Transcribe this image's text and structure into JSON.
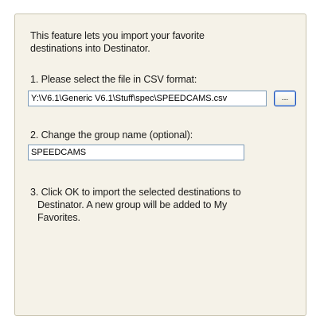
{
  "dialog": {
    "intro_line1": "This feature lets you import your favorite",
    "intro_line2": "destinations into Destinator.",
    "step1_label": "1. Please select the file in CSV format:",
    "file_path_value": "Y:\\V6.1\\Generic V6.1\\Stuff\\spec\\SPEEDCAMS.csv",
    "browse_label": "...",
    "step2_label": "2. Change the group name (optional):",
    "group_name_value": "SPEEDCAMS",
    "step3_line1": "3. Click OK to import the selected destinations to",
    "step3_line2": "Destinator. A new group will be added to My",
    "step3_line3": "Favorites."
  },
  "colors": {
    "panel_background": "#f5f2e8",
    "panel_border": "#c9c4b0",
    "field_border": "#7f9db9",
    "button_border": "#1e4fb4"
  }
}
